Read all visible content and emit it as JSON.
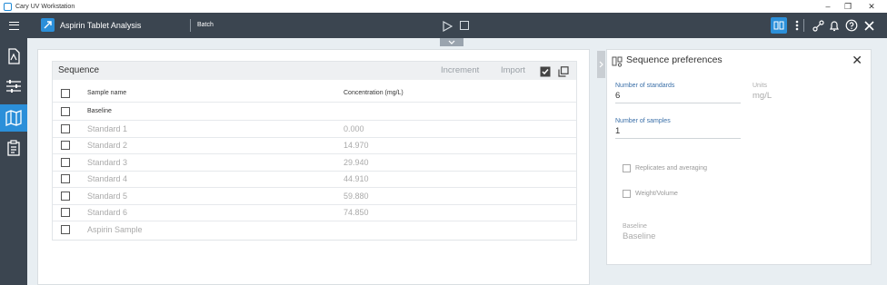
{
  "window": {
    "title": "Cary UV Workstation",
    "controls": [
      "–",
      "❐",
      "✕"
    ]
  },
  "appbar": {
    "document_title": "Aspirin Tablet Analysis",
    "mode_label": "Batch",
    "icons": [
      "method-icon",
      "more-vert-icon",
      "link-icon",
      "bell-icon",
      "help-icon",
      "close-icon"
    ]
  },
  "leftnav": {
    "items": [
      "report-icon",
      "settings-sliders-icon",
      "map-icon",
      "clipboard-icon"
    ],
    "active_index": 2
  },
  "sequence": {
    "title": "Sequence",
    "increment_label": "Increment",
    "import_label": "Import",
    "columns": [
      "Sample name",
      "Concentration (mg/L)"
    ],
    "rows": [
      {
        "name": "Baseline",
        "concentration": "",
        "dark": true
      },
      {
        "name": "Standard 1",
        "concentration": "0.000"
      },
      {
        "name": "Standard 2",
        "concentration": "14.970"
      },
      {
        "name": "Standard 3",
        "concentration": "29.940"
      },
      {
        "name": "Standard 4",
        "concentration": "44.910"
      },
      {
        "name": "Standard 5",
        "concentration": "59.880"
      },
      {
        "name": "Standard 6",
        "concentration": "74.850"
      },
      {
        "name": "Aspirin Sample",
        "concentration": ""
      }
    ]
  },
  "preferences": {
    "title": "Sequence preferences",
    "num_standards_label": "Number of standards",
    "num_standards_value": "6",
    "units_label": "Units",
    "units_value": "mg/L",
    "num_samples_label": "Number of samples",
    "num_samples_value": "1",
    "replicates_label": "Replicates and averaging",
    "weight_volume_label": "Weight/Volume",
    "baseline_label": "Baseline",
    "baseline_value": "Baseline"
  }
}
